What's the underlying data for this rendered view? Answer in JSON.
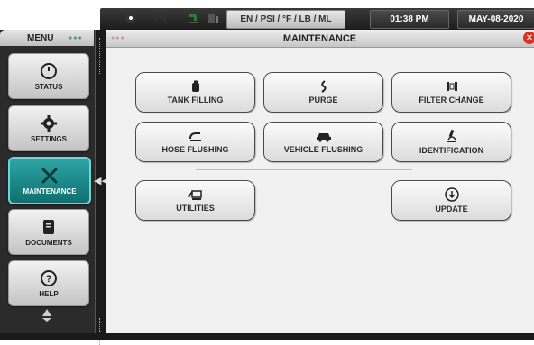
{
  "status_bar": {
    "units": "EN / PSI / °F / LB / ML",
    "time": "01:38 PM",
    "date": "MAY-08-2020",
    "icons": [
      "pressure-icon",
      "wireless-icon",
      "water-tap-icon",
      "tank-flask-icon"
    ]
  },
  "menu": {
    "title": "MENU",
    "items": [
      {
        "label": "STATUS",
        "icon": "gauge-icon"
      },
      {
        "label": "SETTINGS",
        "icon": "gear-icon"
      },
      {
        "label": "MAINTENANCE",
        "icon": "wrench-screwdriver-icon",
        "active": true
      },
      {
        "label": "DOCUMENTS",
        "icon": "document-icon"
      },
      {
        "label": "HELP",
        "icon": "question-icon"
      }
    ],
    "footer_icon": "recycle-icon"
  },
  "main": {
    "title": "MAINTENANCE",
    "buttons": {
      "tank_filling": "TANK FILLING",
      "purge": "PURGE",
      "filter_change": "FILTER CHANGE",
      "hose_flushing": "HOSE FLUSHING",
      "vehicle_flushing": "VEHICLE FLUSHING",
      "identification": "IDENTIFICATION",
      "utilities": "UTILITIES",
      "update": "UPDATE"
    }
  },
  "colors": {
    "active_nav": "#1f8f90",
    "close": "#d93025",
    "dark_bar": "#2b2b2b"
  }
}
